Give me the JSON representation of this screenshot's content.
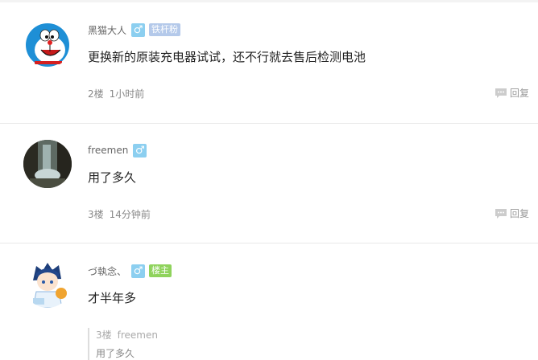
{
  "comments": [
    {
      "username": "黑猫大人",
      "gender_symbol": "♂",
      "badge": "铁杆粉",
      "content": "更换新的原装充电器试试，还不行就去售后检测电池",
      "floor": "2楼",
      "time": "1小时前",
      "reply_label": "回复",
      "avatar_icon": "doraemon-avatar"
    },
    {
      "username": "freemen",
      "gender_symbol": "♂",
      "content": "用了多久",
      "floor": "3楼",
      "time": "14分钟前",
      "reply_label": "回复",
      "avatar_icon": "waterfall-avatar"
    },
    {
      "username": "づ執念、",
      "gender_symbol": "♂",
      "badge": "楼主",
      "content": "才半年多",
      "avatar_icon": "anime-boy-avatar",
      "quote": {
        "floor": "3楼",
        "username": "freemen",
        "content": "用了多久"
      }
    }
  ],
  "colors": {
    "gender_badge": "#8ccff0",
    "fan_badge": "#b4c9ea",
    "owner_badge": "#8fd35c"
  }
}
